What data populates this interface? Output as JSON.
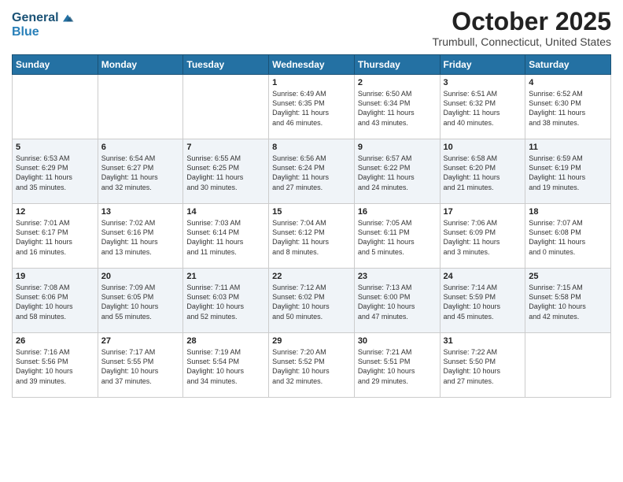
{
  "header": {
    "logo_line1": "General",
    "logo_line2": "Blue",
    "month_title": "October 2025",
    "subtitle": "Trumbull, Connecticut, United States"
  },
  "days_of_week": [
    "Sunday",
    "Monday",
    "Tuesday",
    "Wednesday",
    "Thursday",
    "Friday",
    "Saturday"
  ],
  "weeks": [
    [
      {
        "day": "",
        "content": ""
      },
      {
        "day": "",
        "content": ""
      },
      {
        "day": "",
        "content": ""
      },
      {
        "day": "1",
        "content": "Sunrise: 6:49 AM\nSunset: 6:35 PM\nDaylight: 11 hours\nand 46 minutes."
      },
      {
        "day": "2",
        "content": "Sunrise: 6:50 AM\nSunset: 6:34 PM\nDaylight: 11 hours\nand 43 minutes."
      },
      {
        "day": "3",
        "content": "Sunrise: 6:51 AM\nSunset: 6:32 PM\nDaylight: 11 hours\nand 40 minutes."
      },
      {
        "day": "4",
        "content": "Sunrise: 6:52 AM\nSunset: 6:30 PM\nDaylight: 11 hours\nand 38 minutes."
      }
    ],
    [
      {
        "day": "5",
        "content": "Sunrise: 6:53 AM\nSunset: 6:29 PM\nDaylight: 11 hours\nand 35 minutes."
      },
      {
        "day": "6",
        "content": "Sunrise: 6:54 AM\nSunset: 6:27 PM\nDaylight: 11 hours\nand 32 minutes."
      },
      {
        "day": "7",
        "content": "Sunrise: 6:55 AM\nSunset: 6:25 PM\nDaylight: 11 hours\nand 30 minutes."
      },
      {
        "day": "8",
        "content": "Sunrise: 6:56 AM\nSunset: 6:24 PM\nDaylight: 11 hours\nand 27 minutes."
      },
      {
        "day": "9",
        "content": "Sunrise: 6:57 AM\nSunset: 6:22 PM\nDaylight: 11 hours\nand 24 minutes."
      },
      {
        "day": "10",
        "content": "Sunrise: 6:58 AM\nSunset: 6:20 PM\nDaylight: 11 hours\nand 21 minutes."
      },
      {
        "day": "11",
        "content": "Sunrise: 6:59 AM\nSunset: 6:19 PM\nDaylight: 11 hours\nand 19 minutes."
      }
    ],
    [
      {
        "day": "12",
        "content": "Sunrise: 7:01 AM\nSunset: 6:17 PM\nDaylight: 11 hours\nand 16 minutes."
      },
      {
        "day": "13",
        "content": "Sunrise: 7:02 AM\nSunset: 6:16 PM\nDaylight: 11 hours\nand 13 minutes."
      },
      {
        "day": "14",
        "content": "Sunrise: 7:03 AM\nSunset: 6:14 PM\nDaylight: 11 hours\nand 11 minutes."
      },
      {
        "day": "15",
        "content": "Sunrise: 7:04 AM\nSunset: 6:12 PM\nDaylight: 11 hours\nand 8 minutes."
      },
      {
        "day": "16",
        "content": "Sunrise: 7:05 AM\nSunset: 6:11 PM\nDaylight: 11 hours\nand 5 minutes."
      },
      {
        "day": "17",
        "content": "Sunrise: 7:06 AM\nSunset: 6:09 PM\nDaylight: 11 hours\nand 3 minutes."
      },
      {
        "day": "18",
        "content": "Sunrise: 7:07 AM\nSunset: 6:08 PM\nDaylight: 11 hours\nand 0 minutes."
      }
    ],
    [
      {
        "day": "19",
        "content": "Sunrise: 7:08 AM\nSunset: 6:06 PM\nDaylight: 10 hours\nand 58 minutes."
      },
      {
        "day": "20",
        "content": "Sunrise: 7:09 AM\nSunset: 6:05 PM\nDaylight: 10 hours\nand 55 minutes."
      },
      {
        "day": "21",
        "content": "Sunrise: 7:11 AM\nSunset: 6:03 PM\nDaylight: 10 hours\nand 52 minutes."
      },
      {
        "day": "22",
        "content": "Sunrise: 7:12 AM\nSunset: 6:02 PM\nDaylight: 10 hours\nand 50 minutes."
      },
      {
        "day": "23",
        "content": "Sunrise: 7:13 AM\nSunset: 6:00 PM\nDaylight: 10 hours\nand 47 minutes."
      },
      {
        "day": "24",
        "content": "Sunrise: 7:14 AM\nSunset: 5:59 PM\nDaylight: 10 hours\nand 45 minutes."
      },
      {
        "day": "25",
        "content": "Sunrise: 7:15 AM\nSunset: 5:58 PM\nDaylight: 10 hours\nand 42 minutes."
      }
    ],
    [
      {
        "day": "26",
        "content": "Sunrise: 7:16 AM\nSunset: 5:56 PM\nDaylight: 10 hours\nand 39 minutes."
      },
      {
        "day": "27",
        "content": "Sunrise: 7:17 AM\nSunset: 5:55 PM\nDaylight: 10 hours\nand 37 minutes."
      },
      {
        "day": "28",
        "content": "Sunrise: 7:19 AM\nSunset: 5:54 PM\nDaylight: 10 hours\nand 34 minutes."
      },
      {
        "day": "29",
        "content": "Sunrise: 7:20 AM\nSunset: 5:52 PM\nDaylight: 10 hours\nand 32 minutes."
      },
      {
        "day": "30",
        "content": "Sunrise: 7:21 AM\nSunset: 5:51 PM\nDaylight: 10 hours\nand 29 minutes."
      },
      {
        "day": "31",
        "content": "Sunrise: 7:22 AM\nSunset: 5:50 PM\nDaylight: 10 hours\nand 27 minutes."
      },
      {
        "day": "",
        "content": ""
      }
    ]
  ]
}
